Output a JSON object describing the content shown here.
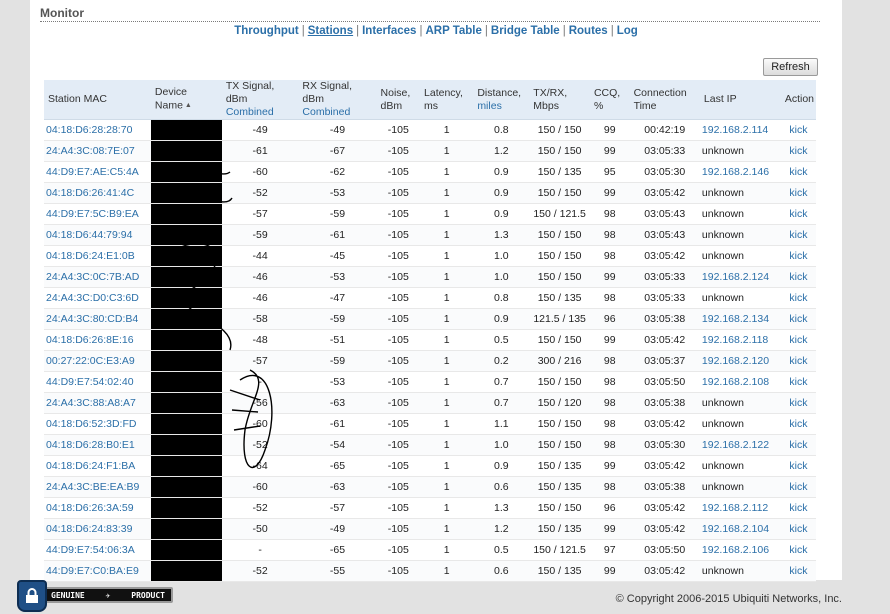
{
  "section": {
    "title": "Monitor"
  },
  "nav": {
    "items": [
      {
        "label": "Throughput",
        "active": false
      },
      {
        "label": "Stations",
        "active": true
      },
      {
        "label": "Interfaces",
        "active": false
      },
      {
        "label": "ARP Table",
        "active": false
      },
      {
        "label": "Bridge Table",
        "active": false
      },
      {
        "label": "Routes",
        "active": false
      },
      {
        "label": "Log",
        "active": false
      }
    ]
  },
  "refresh_label": "Refresh",
  "columns": {
    "mac": "Station MAC",
    "device": "Device Name",
    "tx_signal": "TX Signal, dBm",
    "tx_signal_sub": "Combined",
    "rx_signal": "RX Signal, dBm",
    "rx_signal_sub": "Combined",
    "noise_1": "Noise,",
    "noise_2": "dBm",
    "latency_1": "Latency,",
    "latency_2": "ms",
    "distance_1": "Distance,",
    "distance_2": "miles",
    "txrx_1": "TX/RX,",
    "txrx_2": "Mbps",
    "ccq_1": "CCQ,",
    "ccq_2": "%",
    "conn_1": "Connection",
    "conn_2": "Time",
    "last_ip": "Last IP",
    "action": "Action"
  },
  "stations": [
    {
      "mac": "04:18:D6:28:28:70",
      "tx": "-49",
      "rx": "-49",
      "noise": "-105",
      "latency": "1",
      "distance": "0.8",
      "txrx": "150 / 150",
      "ccq": "99",
      "time": "00:42:19",
      "ip": "192.168.2.114",
      "action": "kick"
    },
    {
      "mac": "24:A4:3C:08:7E:07",
      "tx": "-61",
      "rx": "-67",
      "noise": "-105",
      "latency": "1",
      "distance": "1.2",
      "txrx": "150 / 150",
      "ccq": "99",
      "time": "03:05:33",
      "ip": "unknown",
      "action": "kick"
    },
    {
      "mac": "44:D9:E7:AE:C5:4A",
      "tx": "-60",
      "rx": "-62",
      "noise": "-105",
      "latency": "1",
      "distance": "0.9",
      "txrx": "150 / 135",
      "ccq": "95",
      "time": "03:05:30",
      "ip": "192.168.2.146",
      "action": "kick"
    },
    {
      "mac": "04:18:D6:26:41:4C",
      "tx": "-52",
      "rx": "-53",
      "noise": "-105",
      "latency": "1",
      "distance": "0.9",
      "txrx": "150 / 150",
      "ccq": "99",
      "time": "03:05:42",
      "ip": "unknown",
      "action": "kick"
    },
    {
      "mac": "44:D9:E7:5C:B9:EA",
      "tx": "-57",
      "rx": "-59",
      "noise": "-105",
      "latency": "1",
      "distance": "0.9",
      "txrx": "150 / 121.5",
      "ccq": "98",
      "time": "03:05:43",
      "ip": "unknown",
      "action": "kick"
    },
    {
      "mac": "04:18:D6:44:79:94",
      "tx": "-59",
      "rx": "-61",
      "noise": "-105",
      "latency": "1",
      "distance": "1.3",
      "txrx": "150 / 150",
      "ccq": "98",
      "time": "03:05:43",
      "ip": "unknown",
      "action": "kick"
    },
    {
      "mac": "04:18:D6:24:E1:0B",
      "tx": "-44",
      "rx": "-45",
      "noise": "-105",
      "latency": "1",
      "distance": "1.0",
      "txrx": "150 / 150",
      "ccq": "98",
      "time": "03:05:42",
      "ip": "unknown",
      "action": "kick"
    },
    {
      "mac": "24:A4:3C:0C:7B:AD",
      "tx": "-46",
      "rx": "-53",
      "noise": "-105",
      "latency": "1",
      "distance": "1.0",
      "txrx": "150 / 150",
      "ccq": "99",
      "time": "03:05:33",
      "ip": "192.168.2.124",
      "action": "kick"
    },
    {
      "mac": "24:A4:3C:D0:C3:6D",
      "tx": "-46",
      "rx": "-47",
      "noise": "-105",
      "latency": "1",
      "distance": "0.8",
      "txrx": "150 / 135",
      "ccq": "98",
      "time": "03:05:33",
      "ip": "unknown",
      "action": "kick"
    },
    {
      "mac": "24:A4:3C:80:CD:B4",
      "tx": "-58",
      "rx": "-59",
      "noise": "-105",
      "latency": "1",
      "distance": "0.9",
      "txrx": "121.5 / 135",
      "ccq": "96",
      "time": "03:05:38",
      "ip": "192.168.2.134",
      "action": "kick"
    },
    {
      "mac": "04:18:D6:26:8E:16",
      "tx": "-48",
      "rx": "-51",
      "noise": "-105",
      "latency": "1",
      "distance": "0.5",
      "txrx": "150 / 150",
      "ccq": "99",
      "time": "03:05:42",
      "ip": "192.168.2.118",
      "action": "kick"
    },
    {
      "mac": "00:27:22:0C:E3:A9",
      "tx": "-57",
      "rx": "-59",
      "noise": "-105",
      "latency": "1",
      "distance": "0.2",
      "txrx": "300 / 216",
      "ccq": "98",
      "time": "03:05:37",
      "ip": "192.168.2.120",
      "action": "kick"
    },
    {
      "mac": "44:D9:E7:54:02:40",
      "tx": "-",
      "rx": "-53",
      "noise": "-105",
      "latency": "1",
      "distance": "0.7",
      "txrx": "150 / 150",
      "ccq": "98",
      "time": "03:05:50",
      "ip": "192.168.2.108",
      "action": "kick"
    },
    {
      "mac": "24:A4:3C:88:A8:A7",
      "tx": "-56",
      "rx": "-63",
      "noise": "-105",
      "latency": "1",
      "distance": "0.7",
      "txrx": "150 / 120",
      "ccq": "98",
      "time": "03:05:38",
      "ip": "unknown",
      "action": "kick"
    },
    {
      "mac": "04:18:D6:52:3D:FD",
      "tx": "-60",
      "rx": "-61",
      "noise": "-105",
      "latency": "1",
      "distance": "1.1",
      "txrx": "150 / 150",
      "ccq": "98",
      "time": "03:05:42",
      "ip": "unknown",
      "action": "kick"
    },
    {
      "mac": "04:18:D6:28:B0:E1",
      "tx": "-52",
      "rx": "-54",
      "noise": "-105",
      "latency": "1",
      "distance": "1.0",
      "txrx": "150 / 150",
      "ccq": "98",
      "time": "03:05:30",
      "ip": "192.168.2.122",
      "action": "kick"
    },
    {
      "mac": "04:18:D6:24:F1:BA",
      "tx": "-64",
      "rx": "-65",
      "noise": "-105",
      "latency": "1",
      "distance": "0.9",
      "txrx": "150 / 135",
      "ccq": "99",
      "time": "03:05:42",
      "ip": "unknown",
      "action": "kick"
    },
    {
      "mac": "24:A4:3C:BE:EA:B9",
      "tx": "-60",
      "rx": "-63",
      "noise": "-105",
      "latency": "1",
      "distance": "0.6",
      "txrx": "150 / 135",
      "ccq": "98",
      "time": "03:05:38",
      "ip": "unknown",
      "action": "kick"
    },
    {
      "mac": "04:18:D6:26:3A:59",
      "tx": "-52",
      "rx": "-57",
      "noise": "-105",
      "latency": "1",
      "distance": "1.3",
      "txrx": "150 / 150",
      "ccq": "96",
      "time": "03:05:42",
      "ip": "192.168.2.112",
      "action": "kick"
    },
    {
      "mac": "04:18:D6:24:83:39",
      "tx": "-50",
      "rx": "-49",
      "noise": "-105",
      "latency": "1",
      "distance": "1.2",
      "txrx": "150 / 135",
      "ccq": "99",
      "time": "03:05:42",
      "ip": "192.168.2.104",
      "action": "kick"
    },
    {
      "mac": "44:D9:E7:54:06:3A",
      "tx": "-",
      "rx": "-65",
      "noise": "-105",
      "latency": "1",
      "distance": "0.5",
      "txrx": "150 / 121.5",
      "ccq": "97",
      "time": "03:05:50",
      "ip": "192.168.2.106",
      "action": "kick"
    },
    {
      "mac": "44:D9:E7:C0:BA:E9",
      "tx": "-52",
      "rx": "-55",
      "noise": "-105",
      "latency": "1",
      "distance": "0.6",
      "txrx": "150 / 135",
      "ccq": "99",
      "time": "03:05:42",
      "ip": "unknown",
      "action": "kick"
    }
  ],
  "badge": {
    "left": "GENUINE",
    "right": "PRODUCT",
    "icon": "lock-icon"
  },
  "footer": {
    "copyright": "© Copyright 2006-2015 Ubiquiti Networks, Inc."
  },
  "colors": {
    "link": "#2b6fa8",
    "header_bg": "#e3ecf6",
    "redaction": "#000000"
  }
}
